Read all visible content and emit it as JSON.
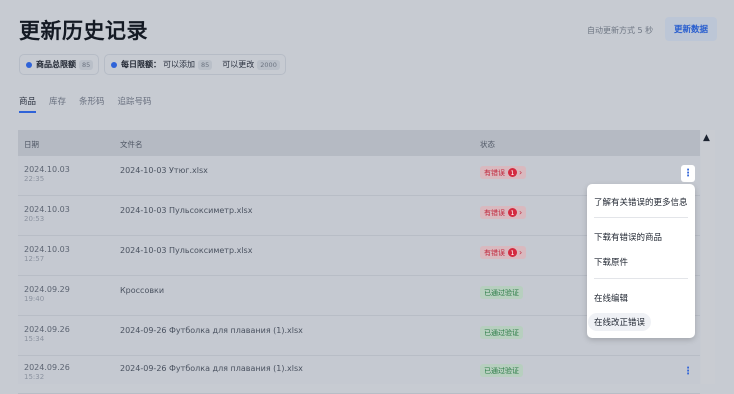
{
  "header": {
    "title": "更新历史记录",
    "auto_refresh": "自动更新方式 5 秒",
    "refresh_button": "更新数据"
  },
  "limits": {
    "total": {
      "label": "商品总限额",
      "value": "85"
    },
    "daily": {
      "label": "每日限额：",
      "add_text": "可以添加",
      "add_value": "85",
      "edit_text": "可以更改",
      "edit_value": "2000"
    }
  },
  "tabs": [
    "商品",
    "库存",
    "条形码",
    "追踪号码"
  ],
  "table": {
    "columns": {
      "date": "日期",
      "file": "文件名",
      "status": "状态"
    },
    "rows": [
      {
        "date": "2024.10.03",
        "time": "22:35",
        "file": "2024-10-03 Утюг.xlsx",
        "status": "有错误",
        "errors": "1"
      },
      {
        "date": "2024.10.03",
        "time": "20:53",
        "file": "2024-10-03 Пульсоксиметр.xlsx",
        "status": "有错误",
        "errors": "1"
      },
      {
        "date": "2024.10.03",
        "time": "12:57",
        "file": "2024-10-03 Пульсоксиметр.xlsx",
        "status": "有错误",
        "errors": "1"
      },
      {
        "date": "2024.09.29",
        "time": "19:40",
        "file": "Кроссовки",
        "status": "已通过验证"
      },
      {
        "date": "2024.09.26",
        "time": "15:34",
        "file": "2024-09-26 Футболка для плавания (1).xlsx",
        "status": "已通过验证"
      },
      {
        "date": "2024.09.26",
        "time": "15:32",
        "file": "2024-09-26 Футболка для плавания (1).xlsx",
        "status": "已通过验证"
      }
    ]
  },
  "menu": {
    "items": [
      "了解有关错误的更多信息",
      "下载有错误的商品",
      "下载原件",
      "在线编辑",
      "在线改正错误"
    ]
  },
  "colors": {
    "accent": "#2f63d8",
    "error": "#c2283c",
    "ok": "#2a7b45"
  }
}
